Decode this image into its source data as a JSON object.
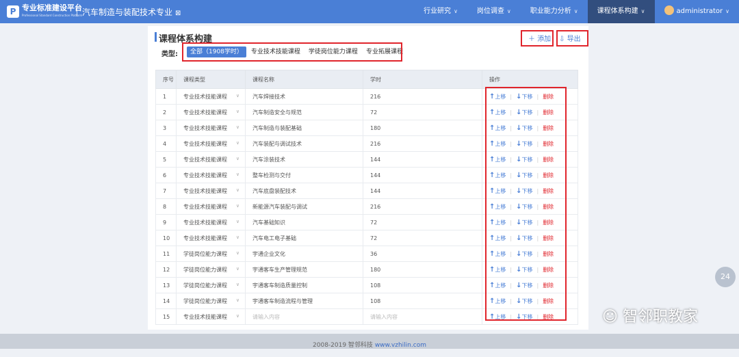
{
  "header": {
    "logo_glyph": "P",
    "brand": "专业标准建设平台",
    "brand_sub": "Professional Standard Construction Platform",
    "app_title": "汽车制造与装配技术专业",
    "nav": [
      "行业研究",
      "岗位调查",
      "职业能力分析",
      "课程体系构建"
    ],
    "user": "administrator"
  },
  "page": {
    "title": "课程体系构建",
    "add_label": "添加",
    "export_label": "导出",
    "type_label": "类型:",
    "tabs": [
      "全部（1908学时）",
      "专业技术技能课程",
      "学徒岗位能力课程",
      "专业拓展课程"
    ]
  },
  "table": {
    "headers": [
      "序号",
      "课程类型",
      "课程名称",
      "学时",
      "操作"
    ],
    "rows": [
      [
        "1",
        "专业技术技能课程",
        "汽车焊接技术",
        "216"
      ],
      [
        "2",
        "专业技术技能课程",
        "汽车制造安全与规范",
        "72"
      ],
      [
        "3",
        "专业技术技能课程",
        "汽车制造与装配基础",
        "180"
      ],
      [
        "4",
        "专业技术技能课程",
        "汽车装配与调试技术",
        "216"
      ],
      [
        "5",
        "专业技术技能课程",
        "汽车涂装技术",
        "144"
      ],
      [
        "6",
        "专业技术技能课程",
        "整车检测与交付",
        "144"
      ],
      [
        "7",
        "专业技术技能课程",
        "汽车底盘装配技术",
        "144"
      ],
      [
        "8",
        "专业技术技能课程",
        "新能源汽车装配与调试",
        "216"
      ],
      [
        "9",
        "专业技术技能课程",
        "汽车基础知识",
        "72"
      ],
      [
        "10",
        "专业技术技能课程",
        "汽车电工电子基础",
        "72"
      ],
      [
        "11",
        "学徒岗位能力课程",
        "宇通企业文化",
        "36"
      ],
      [
        "12",
        "学徒岗位能力课程",
        "宇通客车生产管理规范",
        "180"
      ],
      [
        "13",
        "学徒岗位能力课程",
        "宇通客车制造质量控制",
        "108"
      ],
      [
        "14",
        "学徒岗位能力课程",
        "宇通客车制造流程与管理",
        "108"
      ],
      [
        "15",
        "专业技术技能课程",
        "请输入内容",
        "请输入内容"
      ]
    ],
    "ops": {
      "up": "上移",
      "down": "下移",
      "del": "删除"
    }
  },
  "footer": {
    "copyright": "2008-2019 智邻科技",
    "url": "www.vzhilin.com"
  },
  "float_badge": "24",
  "watermark": "智邻职教家"
}
